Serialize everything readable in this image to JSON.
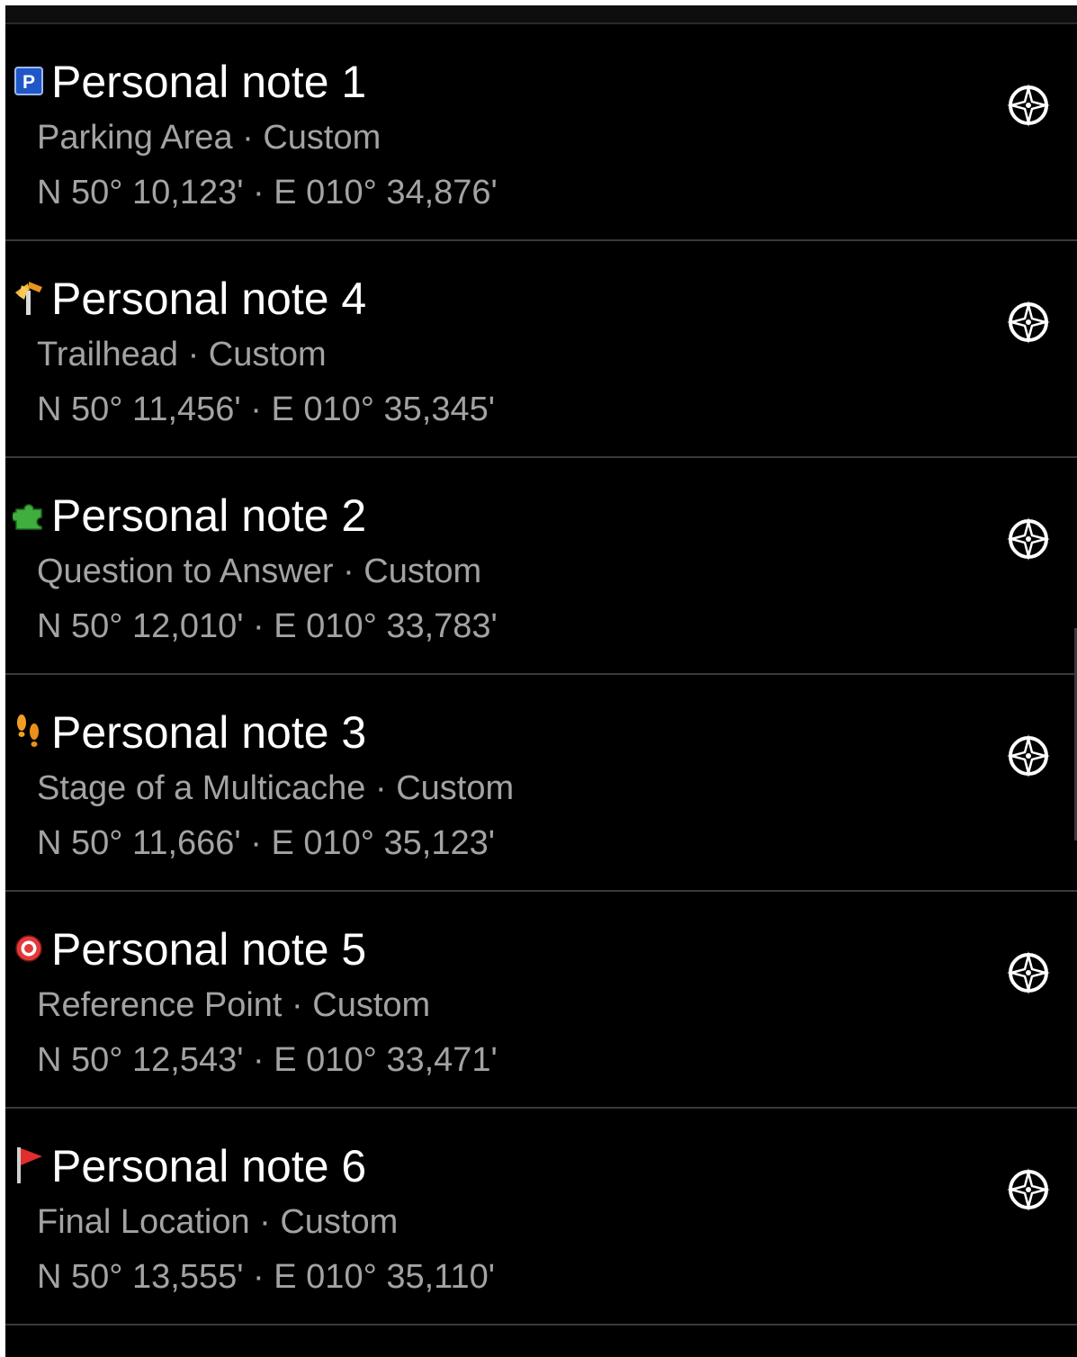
{
  "waypoints": [
    {
      "title": "Personal note 1",
      "subtitle": "Parking Area · Custom",
      "coords": "N 50° 10,123' · E 010° 34,876'",
      "icon": "parking-icon"
    },
    {
      "title": "Personal note 4",
      "subtitle": "Trailhead · Custom",
      "coords": "N 50° 11,456' · E 010° 35,345'",
      "icon": "trailhead-icon"
    },
    {
      "title": "Personal note 2",
      "subtitle": "Question to Answer · Custom",
      "coords": "N 50° 12,010' · E 010° 33,783'",
      "icon": "puzzle-icon"
    },
    {
      "title": "Personal note 3",
      "subtitle": "Stage of a Multicache · Custom",
      "coords": "N 50° 11,666' · E 010° 35,123'",
      "icon": "footprints-icon"
    },
    {
      "title": "Personal note 5",
      "subtitle": "Reference Point · Custom",
      "coords": "N 50° 12,543' · E 010° 33,471'",
      "icon": "reference-point-icon"
    },
    {
      "title": "Personal note 6",
      "subtitle": "Final Location · Custom",
      "coords": "N 50° 13,555' · E 010° 35,110'",
      "icon": "flag-icon"
    }
  ],
  "nav_icon": "compass-navigate-icon",
  "colors": {
    "background": "#000000",
    "title": "#ffffff",
    "secondary_text": "#a3a3a3",
    "divider": "#3a3a3a"
  }
}
